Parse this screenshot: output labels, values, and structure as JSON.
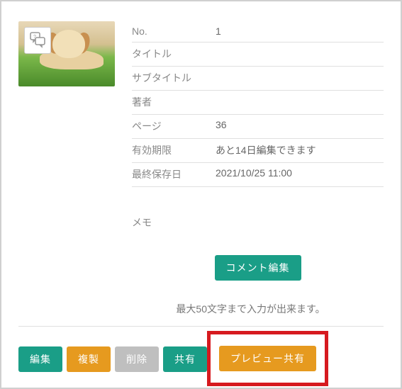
{
  "details": {
    "rows": [
      {
        "label": "No.",
        "value": "1"
      },
      {
        "label": "タイトル",
        "value": ""
      },
      {
        "label": "サブタイトル",
        "value": ""
      },
      {
        "label": "著者",
        "value": ""
      },
      {
        "label": "ページ",
        "value": "36"
      },
      {
        "label": "有効期限",
        "value": "あと14日編集できます"
      },
      {
        "label": "最終保存日",
        "value": "2021/10/25 11:00"
      }
    ]
  },
  "memo": {
    "label": "メモ"
  },
  "buttons": {
    "comment_edit": "コメント編集",
    "edit": "編集",
    "duplicate": "複製",
    "delete": "削除",
    "share": "共有",
    "preview_share": "プレビュー共有"
  },
  "hint": "最大50文字まで入力が出来ます。",
  "icons": {
    "callout": "speech-balloon-swap-icon"
  }
}
